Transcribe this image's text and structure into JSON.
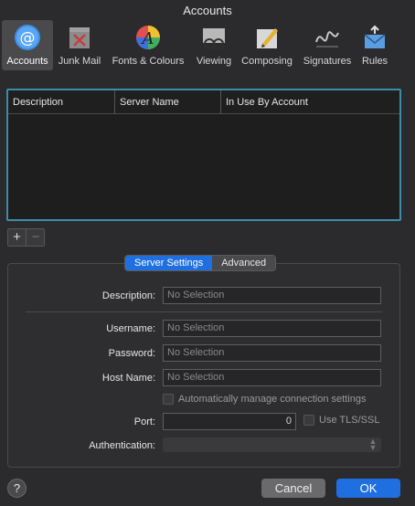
{
  "window": {
    "title": "Accounts"
  },
  "toolbar": {
    "items": [
      {
        "label": "Accounts",
        "icon": "at-sign-icon",
        "active": true
      },
      {
        "label": "Junk Mail",
        "icon": "junk-mail-icon",
        "active": false
      },
      {
        "label": "Fonts & Colours",
        "icon": "fonts-colours-icon",
        "active": false
      },
      {
        "label": "Viewing",
        "icon": "viewing-glasses-icon",
        "active": false
      },
      {
        "label": "Composing",
        "icon": "composing-pencil-icon",
        "active": false
      },
      {
        "label": "Signatures",
        "icon": "signature-icon",
        "active": false
      },
      {
        "label": "Rules",
        "icon": "rules-envelope-icon",
        "active": false
      }
    ]
  },
  "accounts_table": {
    "columns": [
      "Description",
      "Server Name",
      "In Use By Account"
    ],
    "rows": []
  },
  "list_controls": {
    "add": "+",
    "remove": "−"
  },
  "tabs": {
    "server_settings": "Server Settings",
    "advanced": "Advanced",
    "selected": "Server Settings"
  },
  "form": {
    "description_label": "Description:",
    "description_value": "No Selection",
    "username_label": "Username:",
    "username_value": "No Selection",
    "password_label": "Password:",
    "password_value": "No Selection",
    "hostname_label": "Host Name:",
    "hostname_value": "No Selection",
    "auto_manage_label": "Automatically manage connection settings",
    "port_label": "Port:",
    "port_value": "0",
    "tls_label": "Use TLS/SSL",
    "auth_label": "Authentication:",
    "auth_value": ""
  },
  "footer": {
    "help": "?",
    "cancel": "Cancel",
    "ok": "OK"
  },
  "colors": {
    "accent": "#1f6fe0",
    "table_focus": "#3a8ea8",
    "background": "#2b2b2d"
  }
}
